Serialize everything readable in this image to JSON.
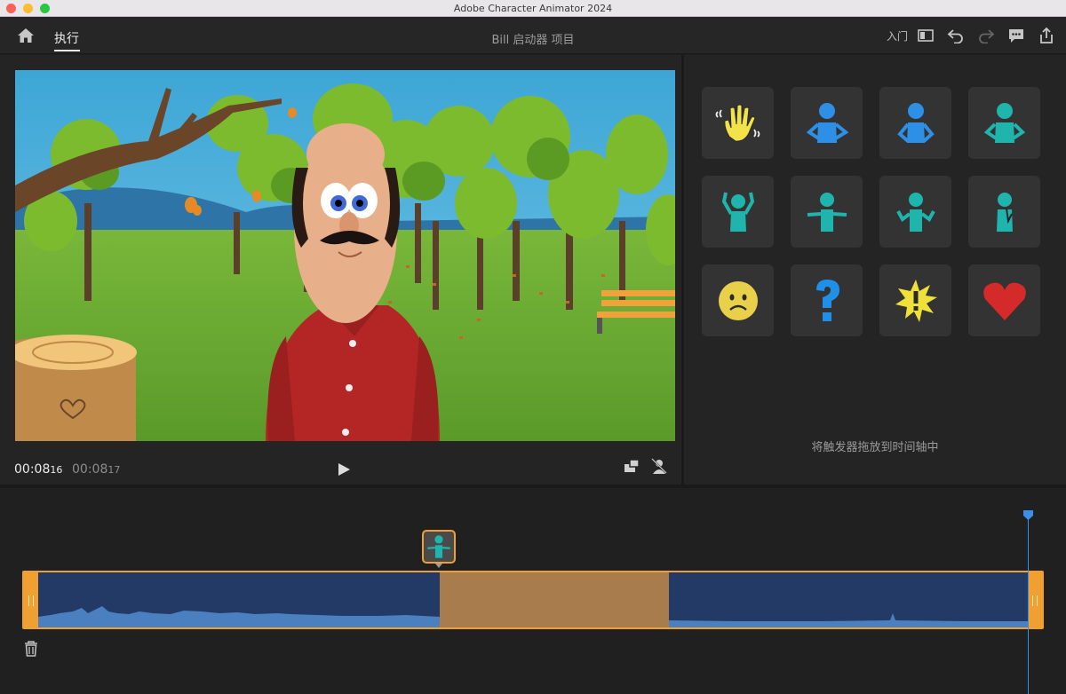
{
  "window": {
    "title": "Adobe Character Animator 2024"
  },
  "header": {
    "tab_label": "执行",
    "project_title": "Bill 启动器 项目",
    "intro_label": "入门"
  },
  "stage": {
    "current_time": "00:08",
    "current_frame": "16",
    "total_time": "00:08",
    "total_frame": "17"
  },
  "triggers": {
    "items": [
      "wave-hands",
      "arms-down-left",
      "hands-on-hips",
      "arms-crossed",
      "arms-raised",
      "arms-out",
      "shrug",
      "hand-on-chin",
      "sad-face",
      "question-mark",
      "exclamation-burst",
      "heart"
    ],
    "drop_hint": "将触发器拖放到时间轴中"
  },
  "timeline": {
    "marker_trigger": "arms-out",
    "playhead_color": "#3d8ee8"
  },
  "colors": {
    "accent": "#f0a030",
    "track_blue": "#233a66",
    "trigger_teal": "#1fb5ad",
    "trigger_blue": "#2d8fe6"
  }
}
